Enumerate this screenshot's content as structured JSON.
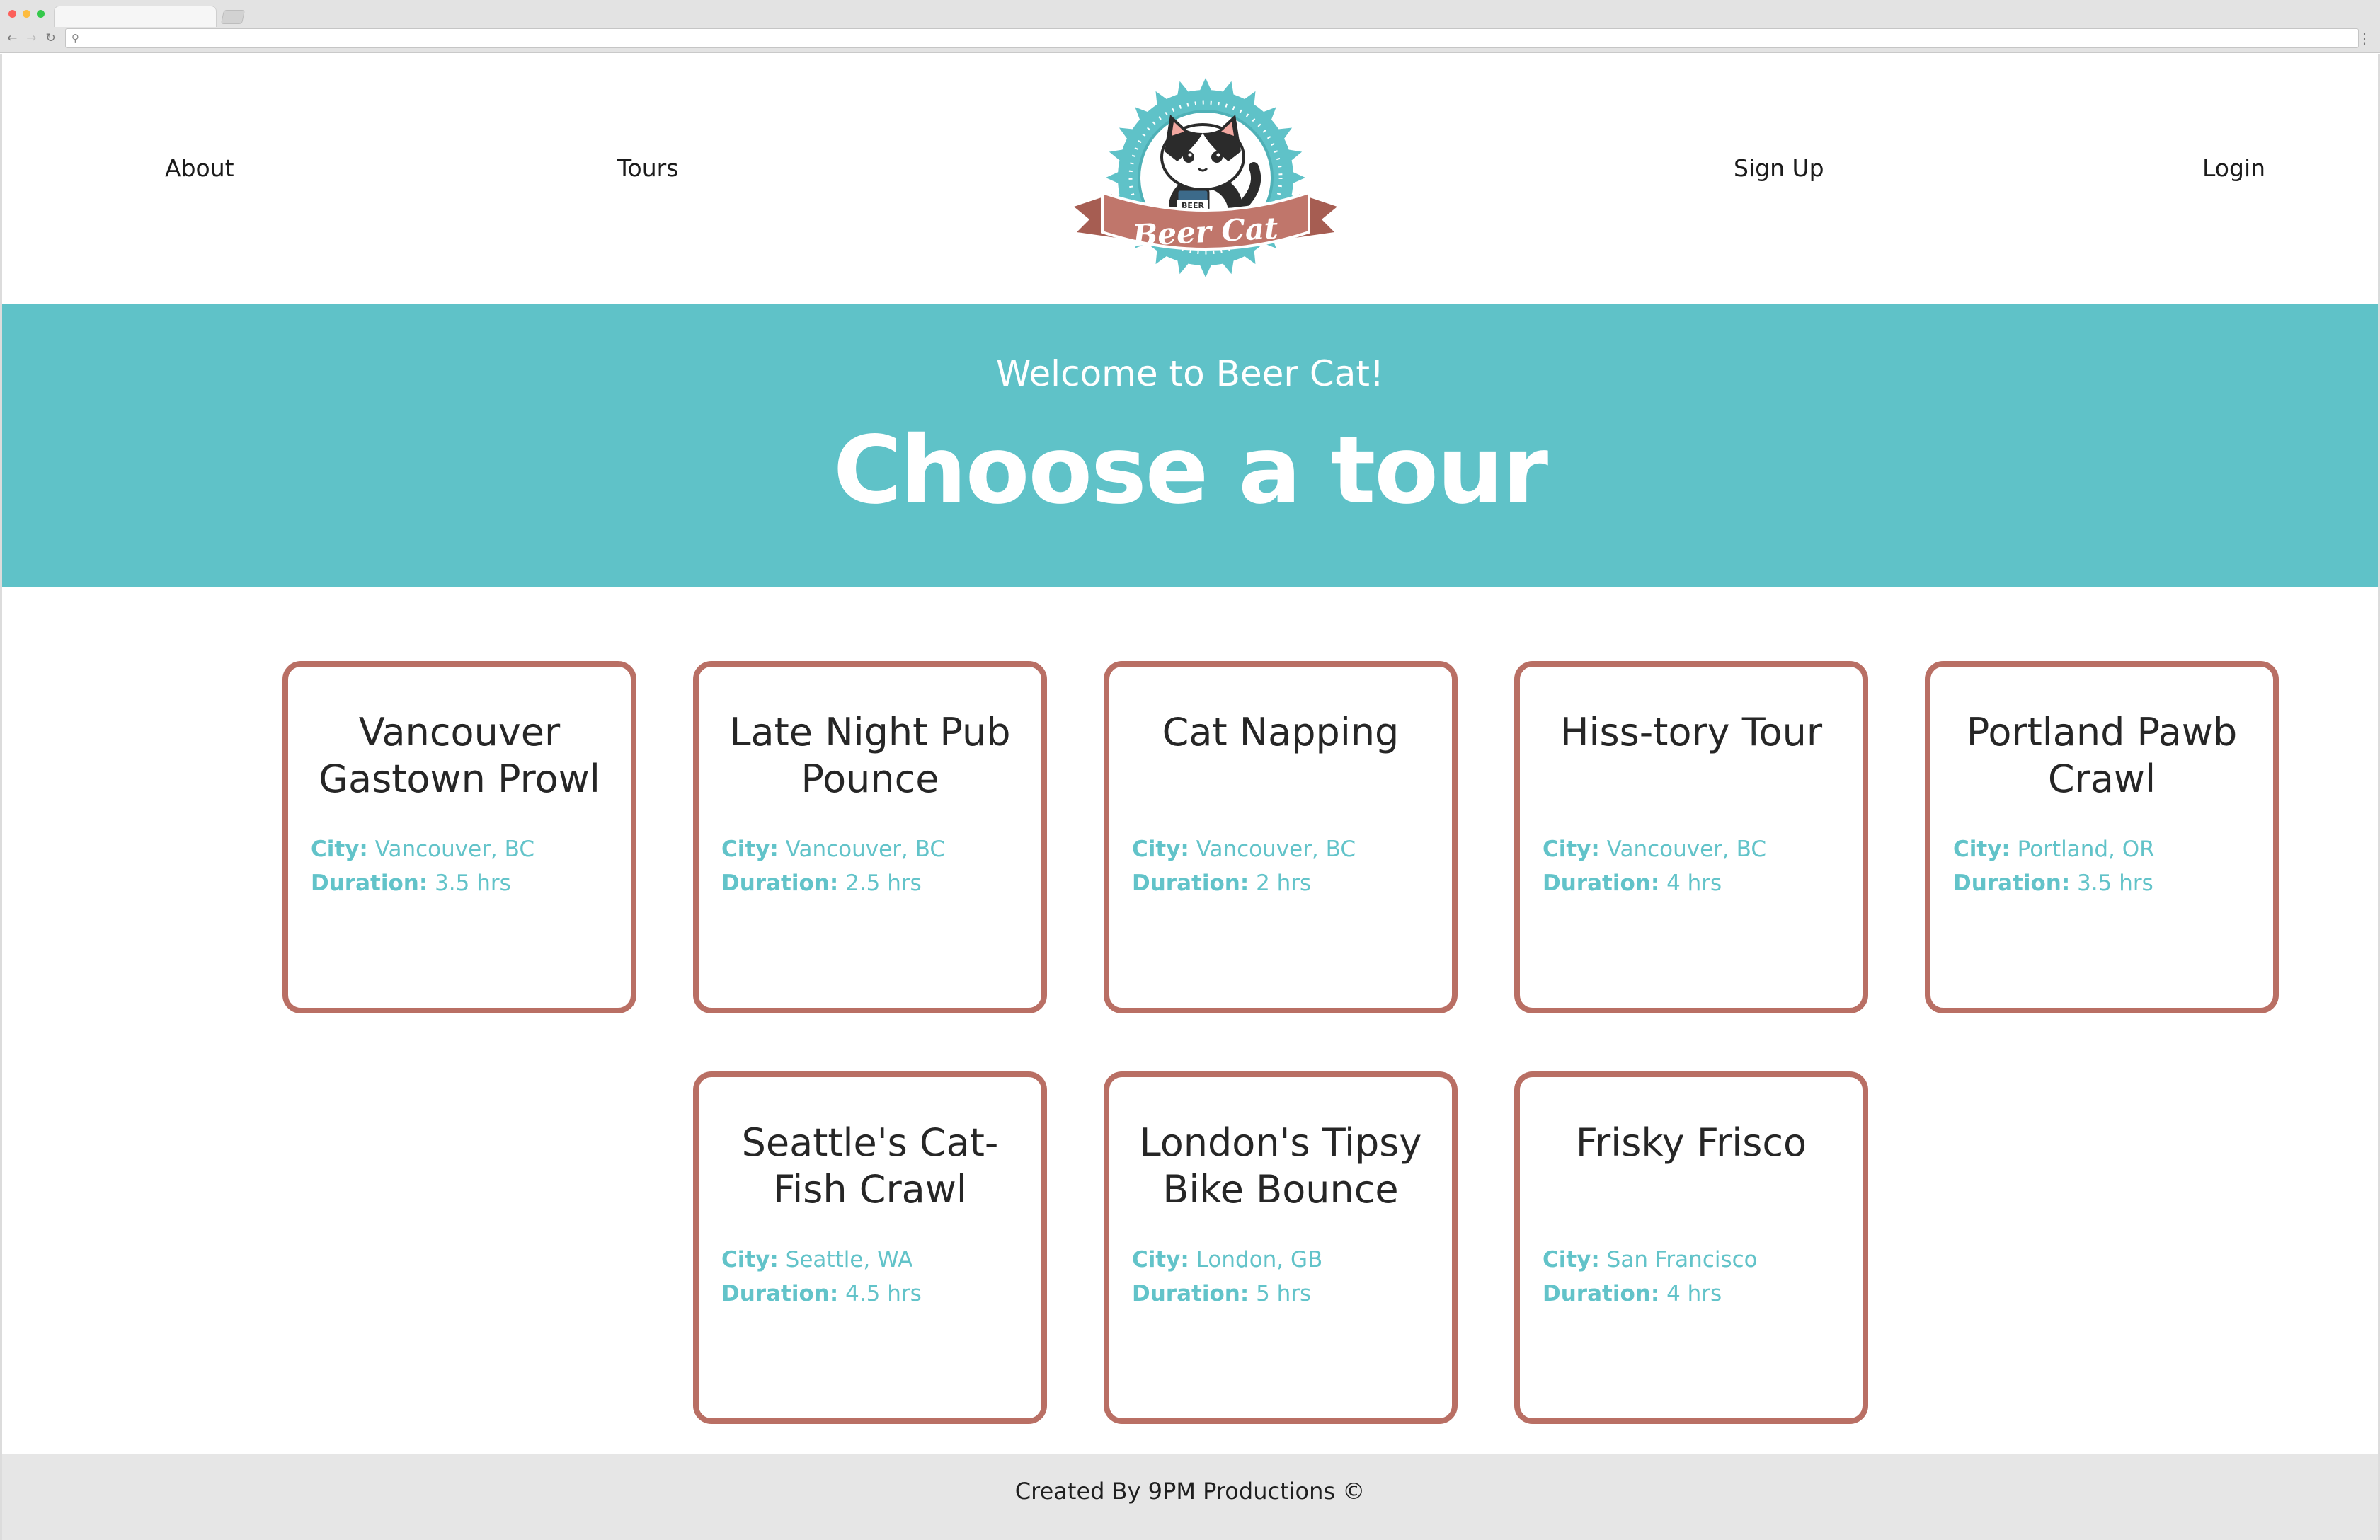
{
  "nav": {
    "about": "About",
    "tours": "Tours",
    "signup": "Sign Up",
    "login": "Login"
  },
  "logo": {
    "text": "Beer Cat",
    "can_text": "BEER"
  },
  "hero": {
    "welcome": "Welcome to Beer Cat!",
    "title": "Choose a tour"
  },
  "labels": {
    "city": "City:",
    "duration": "Duration:"
  },
  "tours": [
    {
      "name": "Vancouver Gastown Prowl",
      "city": "Vancouver, BC",
      "duration": "3.5 hrs"
    },
    {
      "name": "Late Night Pub Pounce",
      "city": "Vancouver, BC",
      "duration": "2.5 hrs"
    },
    {
      "name": "Cat Napping",
      "city": "Vancouver, BC",
      "duration": "2 hrs"
    },
    {
      "name": "Hiss-tory Tour",
      "city": "Vancouver, BC",
      "duration": "4 hrs"
    },
    {
      "name": "Portland Pawb Crawl",
      "city": "Portland, OR",
      "duration": "3.5 hrs"
    },
    {
      "name": "Seattle's Cat-Fish Crawl",
      "city": "Seattle, WA",
      "duration": "4.5 hrs"
    },
    {
      "name": "London's Tipsy Bike Bounce",
      "city": "London, GB",
      "duration": "5 hrs"
    },
    {
      "name": "Frisky Frisco",
      "city": "San Francisco",
      "duration": "4 hrs"
    }
  ],
  "footer": {
    "text": "Created By 9PM Productions ©"
  },
  "colors": {
    "accent": "#5fc2c8",
    "card_border": "#b96f64",
    "footer_bg": "#e6e6e6"
  }
}
